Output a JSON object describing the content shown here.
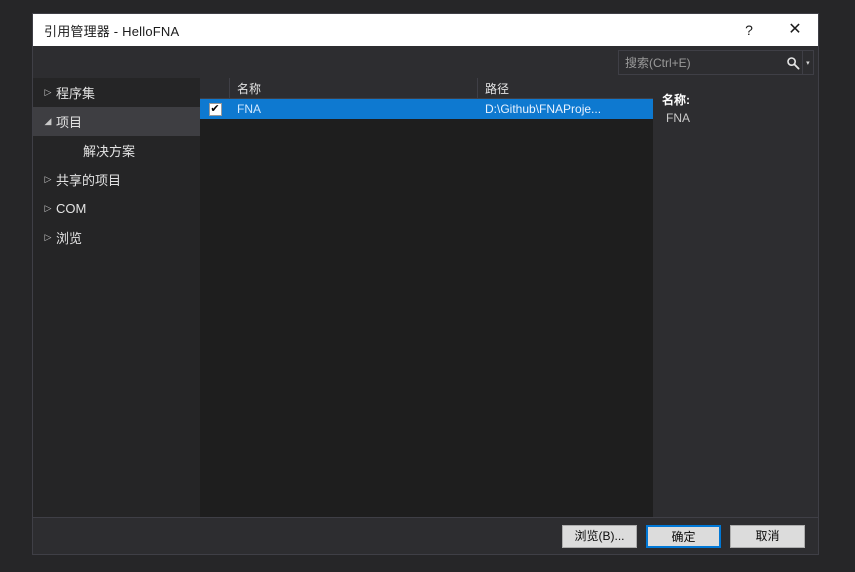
{
  "window": {
    "title": "引用管理器 - HelloFNA",
    "help_icon": "?",
    "close_icon": "✕"
  },
  "search": {
    "placeholder": "搜索(Ctrl+E)",
    "value": "",
    "icon": "search-icon",
    "caret": "▾"
  },
  "sidebar": {
    "items": [
      {
        "label": "程序集",
        "arrow": "▷",
        "expanded": false,
        "selected": false,
        "child": false
      },
      {
        "label": "项目",
        "arrow": "◢",
        "expanded": true,
        "selected": true,
        "child": false
      },
      {
        "label": "解决方案",
        "arrow": "",
        "expanded": false,
        "selected": false,
        "child": true
      },
      {
        "label": "共享的项目",
        "arrow": "▷",
        "expanded": false,
        "selected": false,
        "child": false
      },
      {
        "label": "COM",
        "arrow": "▷",
        "expanded": false,
        "selected": false,
        "child": false
      },
      {
        "label": "浏览",
        "arrow": "▷",
        "expanded": false,
        "selected": false,
        "child": false
      }
    ]
  },
  "list": {
    "columns": [
      "",
      "名称",
      "路径"
    ],
    "rows": [
      {
        "checked": true,
        "check_glyph": "✔",
        "name": "FNA",
        "path": "D:\\Github\\FNAProje..."
      }
    ]
  },
  "detail": {
    "name_label": "名称:",
    "name_value": "FNA"
  },
  "footer": {
    "browse_label": "浏览(B)...",
    "ok_label": "确定",
    "cancel_label": "取消"
  },
  "colors": {
    "accent": "#0e79d0",
    "focus_border": "#0078d7",
    "dialog_bg": "#2d2d30",
    "sidebar_bg": "#252526",
    "list_bg": "#1e1e1e",
    "titlebar_bg": "#ffffff"
  }
}
